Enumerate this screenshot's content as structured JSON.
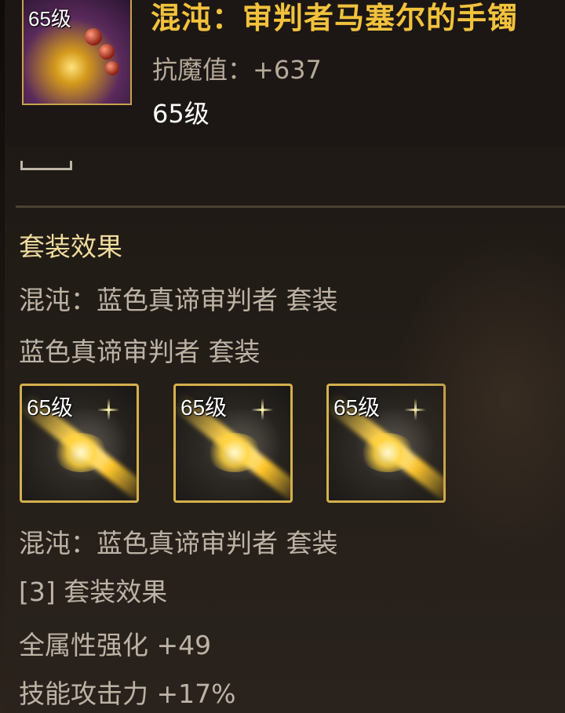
{
  "item": {
    "level_badge": "65级",
    "name": "混沌：审判者马塞尔的手镯",
    "stat": "抗魔值：+637",
    "level": "65级"
  },
  "set_section": {
    "title": "套装效果",
    "set_name_line1": "混沌：蓝色真谛审判者  套装",
    "set_name_line2": "蓝色真谛审判者  套装",
    "pieces": [
      {
        "level_badge": "65级"
      },
      {
        "level_badge": "65级"
      },
      {
        "level_badge": "65级"
      }
    ],
    "set_name_line3": "混沌：蓝色真谛审判者  套装",
    "effect_header": "[3] 套装效果",
    "effects": [
      "全属性强化 +49",
      "技能攻击力 +17%"
    ]
  },
  "colors": {
    "item_name": "#f2c23c",
    "set_title": "#f0dc9c",
    "gray_text": "#bdb3a6",
    "frame_gold": "#d4b04c"
  }
}
